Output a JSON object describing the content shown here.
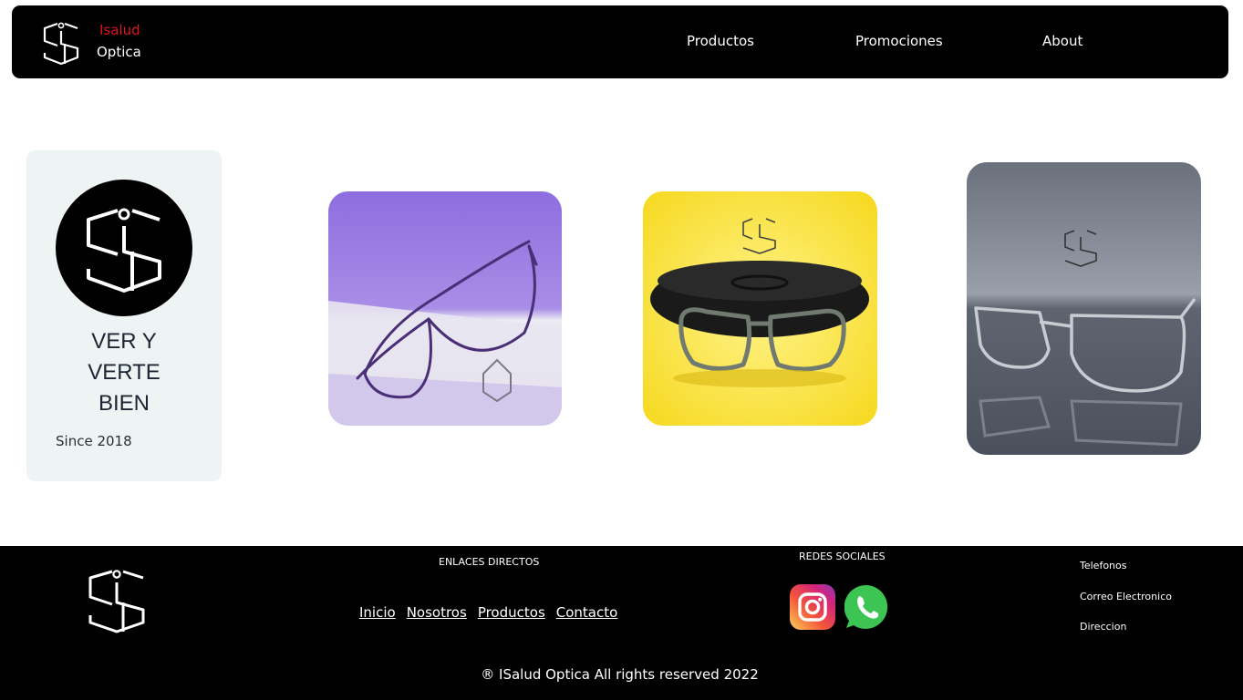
{
  "header": {
    "brand_line1": "Isalud",
    "brand_line2": "Optica",
    "brand_colors": {
      "accent": "#e0141e",
      "text": "#ffffff",
      "background": "#000000"
    },
    "logo_icon": "isalud-logo-icon",
    "nav": [
      {
        "label": "Productos"
      },
      {
        "label": "Promociones"
      },
      {
        "label": "About"
      }
    ]
  },
  "hero": {
    "tagline": [
      "VER Y",
      "VERTE",
      "BIEN"
    ],
    "since": "Since 2018",
    "card_color": "#eef4f3"
  },
  "gallery": {
    "photos": [
      {
        "name": "purple-glasses-photo",
        "background": "#8f6ee0"
      },
      {
        "name": "yellow-glasses-photo",
        "background": "#f7dc2a"
      },
      {
        "name": "grey-glasses-photo",
        "background": "#6e7480"
      }
    ]
  },
  "footer": {
    "links_heading": "ENLACES DIRECTOS",
    "links": [
      "Inicio",
      "Nosotros",
      "Productos",
      "Contacto"
    ],
    "social_heading": "REDES SOCIALES",
    "social_icons": [
      "instagram-icon",
      "whatsapp-icon"
    ],
    "contact": [
      "Telefonos",
      "Correo Electronico",
      "Direccion"
    ],
    "copyright": "® ISalud Optica All rights reserved 2022"
  }
}
